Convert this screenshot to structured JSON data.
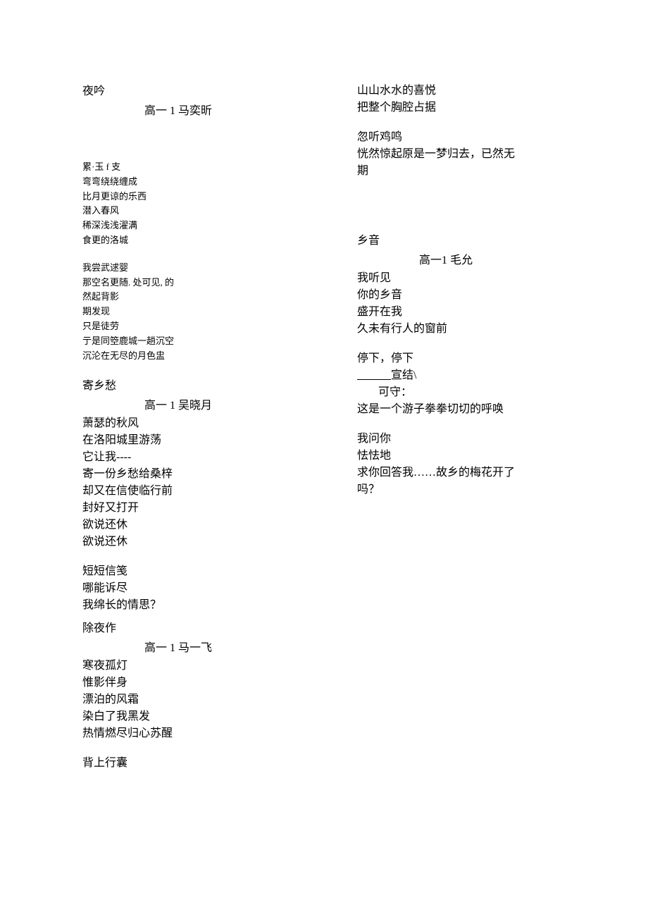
{
  "left": {
    "poem1": {
      "title": "夜吟",
      "author": "高一 1 马奕昕",
      "stanza1": {
        "l1": "累·玉 f 支",
        "l2": "弯弯绕绕缠成",
        "l3": "比月更谅的乐西",
        "l4": "潜入春风",
        "l5": "稀深浅浅濯满",
        "l6": "食更的洛城"
      },
      "stanza2": {
        "l1": "我尝武逑婴",
        "l2": "那空名更随. 处可见, 的",
        "l3": "然起背影",
        "l4": "期发现",
        "l5": "只是徒劳",
        "l6": "亍是同箜鹿城一趟沉空",
        "l7": "沉沦在无尽的月色盅"
      }
    },
    "poem2": {
      "title": "寄乡愁",
      "author": "高一 1 吴晓月",
      "stanza1": {
        "l1": "萧瑟的秋风",
        "l2": "在洛阳城里游荡",
        "l3": "它让我----",
        "l4": "寄一份乡愁给桑梓",
        "l5": "却又在信使临行前",
        "l6": "封好又打开",
        "l7": "欲说还休",
        "l8": "欲说还休"
      },
      "stanza2": {
        "l1": "短短信笺",
        "l2": "哪能诉尽",
        "l3": "我绵长的情思？"
      }
    },
    "poem3": {
      "title": "除夜作",
      "author": "高一 1 马一飞",
      "stanza1": {
        "l1": "寒夜孤灯",
        "l2": "惟影伴身",
        "l3": "漂泊的风霜",
        "l4": "染白了我黑发",
        "l5": "热情燃尽归心苏醒"
      },
      "stanza2": {
        "l1": "背上行囊"
      }
    }
  },
  "right": {
    "top": {
      "stanza1": {
        "l1": "山山水水的喜悦",
        "l2": "把整个胸腔占据"
      },
      "stanza2": {
        "l1": "忽听鸡鸣",
        "l2": "恍然惊起原是一梦归去，已然无",
        "l3": "期"
      }
    },
    "poem4": {
      "title": "乡音",
      "author": "高一1 毛允",
      "stanza1": {
        "l1": "我听见",
        "l2": "你的乡音",
        "l3": "盛开在我",
        "l4": "久未有行人的窗前"
      },
      "stanza2": {
        "l1": "停下，停下",
        "l2a": "　　　",
        "l2b": "宣结\\",
        "l3": "可守：",
        "l4": "这是一个游子拳拳切切的呼唤"
      },
      "stanza3": {
        "l1": "我问你",
        "l2": "怯怯地",
        "l3": "求你回答我……故乡的梅花开了",
        "l4": "吗？"
      }
    }
  }
}
